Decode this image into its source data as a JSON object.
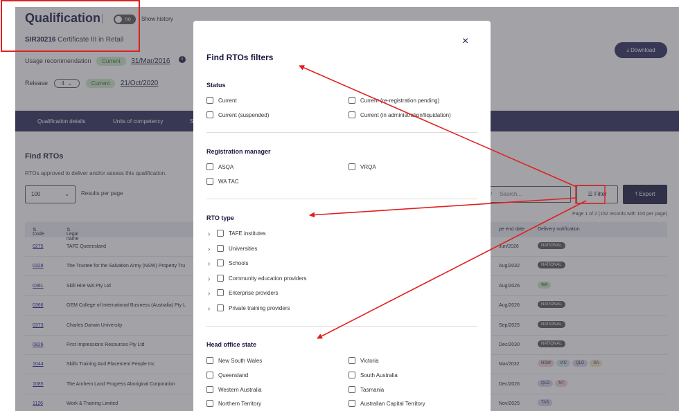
{
  "header": {
    "title": "Qualification",
    "toggle_label": "no",
    "show_history": "Show history",
    "code": "SIR30216",
    "code_name": "Certificate III in Retail",
    "usage_label": "Usage recommendation",
    "usage_status": "Current",
    "usage_date": "31/Mar/2016",
    "download_label": "Download",
    "release_label": "Release",
    "release_value": "4",
    "release_status": "Current",
    "release_date": "21/Oct/2020"
  },
  "nav": {
    "tab1": "Qualification details",
    "tab2": "Units of competency",
    "tab3": "S"
  },
  "find": {
    "title": "Find RTOs",
    "subtitle": "RTOs approved to deliver and/or assess this qualification.",
    "per_page_value": "100",
    "per_page_label": "Results per page",
    "search_placeholder": "Search...",
    "filter_label": "Filter",
    "export_label": "Export",
    "page_info": "Page 1 of 2 (152 records with 100 per page)"
  },
  "table": {
    "headers": {
      "code": "Code",
      "name": "Legal name",
      "date": "pe end date",
      "delivery": "Delivery notification"
    },
    "rows": [
      {
        "code": "0275",
        "name": "TAFE Queensland",
        "date": "Jun/2026",
        "tags": [
          "NATIONAL"
        ]
      },
      {
        "code": "0328",
        "name": "The Trustee for the Salvation Army (NSW) Property Tru",
        "date": "Aug/2032",
        "tags": [
          "NATIONAL"
        ]
      },
      {
        "code": "0361",
        "name": "Skill Hire WA Pty Ltd",
        "date": "Aug/2026",
        "tags": [
          "WA"
        ]
      },
      {
        "code": "0366",
        "name": "GEM College of International Business (Australia) Pty L",
        "date": "Aug/2026",
        "tags": [
          "NATIONAL"
        ]
      },
      {
        "code": "0373",
        "name": "Charles Darwin University",
        "date": "Sep/2025",
        "tags": [
          "NATIONAL"
        ]
      },
      {
        "code": "0826",
        "name": "First Impressions Resources Pty Ltd",
        "date": "Dec/2030",
        "tags": [
          "NATIONAL"
        ]
      },
      {
        "code": "1044",
        "name": "Skills Training And Placement People Inc",
        "date": "Mar/2032",
        "tags": [
          "NSW",
          "VIC",
          "QLD",
          "SA"
        ]
      },
      {
        "code": "1085",
        "name": "The Arnhem Land Progress Aboriginal Corporation",
        "date": "Dec/2026",
        "tags": [
          "QLD",
          "NT"
        ]
      },
      {
        "code": "1126",
        "name": "Work & Training Limited",
        "date": "Nov/2025",
        "tags": [
          "TAS"
        ]
      }
    ]
  },
  "tag_colors": {
    "NATIONAL": "#555555",
    "WA": "#c9e6c2",
    "NSW": "#f3d0d6",
    "VIC": "#cfe3ef",
    "QLD": "#d8d2ea",
    "SA": "#efe5c6",
    "NT": "#f3d0d6",
    "TAS": "#d8d2ea"
  },
  "modal": {
    "close_icon": "×",
    "title": "Find RTOs filters",
    "status": {
      "heading": "Status",
      "options": [
        "Current",
        "Current (re-registration pending)",
        "Current (suspended)",
        "Current (in administration/liquidation)"
      ]
    },
    "registration": {
      "heading": "Registration manager",
      "options": [
        "ASQA",
        "VRQA",
        "WA TAC"
      ]
    },
    "rto_type": {
      "heading": "RTO type",
      "options": [
        "TAFE institutes",
        "Universities",
        "Schools",
        "Community education providers",
        "Enterprise providers",
        "Private training providers"
      ]
    },
    "head_office": {
      "heading": "Head office state",
      "options": [
        "New South Wales",
        "Victoria",
        "Queensland",
        "South Australia",
        "Western Australia",
        "Tasmania",
        "Northern Territory",
        "Australian Capital Territory"
      ]
    }
  },
  "annotation_color": "#e02020"
}
